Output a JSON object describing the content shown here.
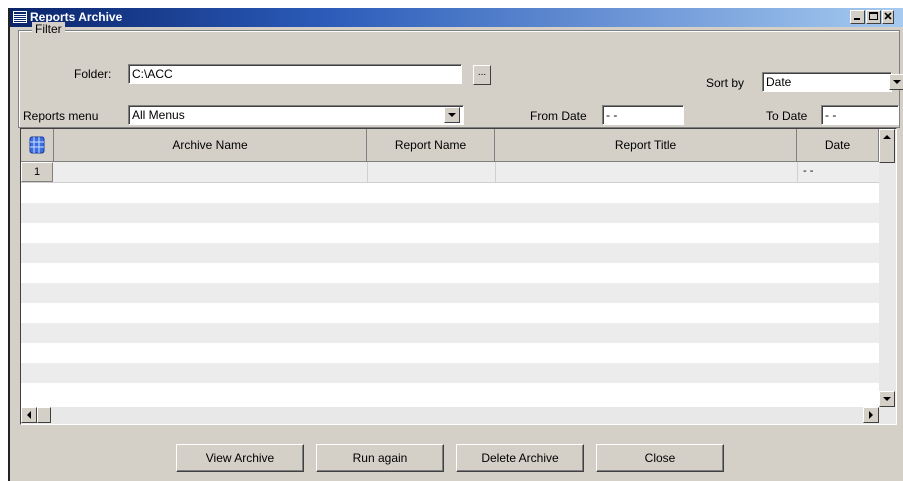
{
  "window": {
    "title": "Reports Archive"
  },
  "filter": {
    "group_label": "Filter",
    "folder_label": "Folder:",
    "folder_value": "C:\\ACC",
    "browse_label": "...",
    "reports_menu_label": "Reports menu",
    "reports_menu_value": "All Menus",
    "sort_by_label": "Sort by",
    "sort_by_value": "Date",
    "from_date_label": "From Date",
    "from_date_value": "- -",
    "to_date_label": "To Date",
    "to_date_value": "- -"
  },
  "grid": {
    "columns": [
      "Archive Name",
      "Report Name",
      "Report Title",
      "Date"
    ],
    "rows": [
      {
        "num": "1",
        "archive_name": "",
        "report_name": "",
        "report_title": "",
        "date": "- -"
      }
    ]
  },
  "buttons": {
    "view_archive": "View Archive",
    "run_again": "Run again",
    "delete_archive": "Delete Archive",
    "close": "Close"
  }
}
